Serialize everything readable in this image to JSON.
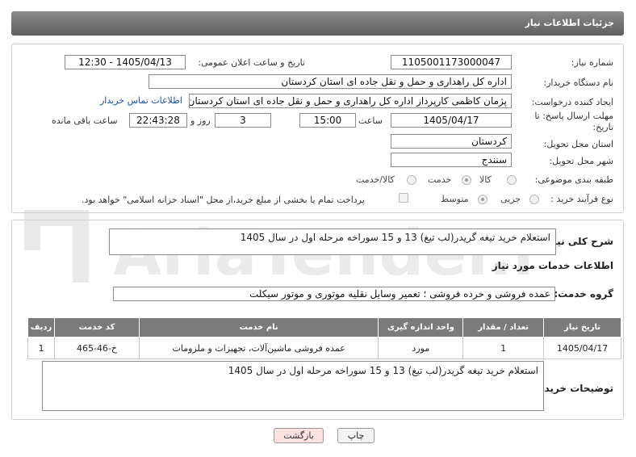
{
  "header": {
    "title": "جزئیات اطلاعات نیاز"
  },
  "form": {
    "need_number_label": "شماره نیاز:",
    "need_number": "1105001173000047",
    "announce_label": "تاریخ و ساعت اعلان عمومی:",
    "announce_value": "1405/04/13 - 12:30",
    "buyer_label": "نام دستگاه خریدار:",
    "buyer_value": "اداره کل راهداری و حمل و نقل جاده ای استان کردستان",
    "creator_label": "ایجاد کننده درخواست:",
    "creator_value": "پژمان کاظمی کارپرداز اداره کل راهداری و حمل و نقل جاده ای استان کردستان",
    "contact_link": "اطلاعات تماس خریدار",
    "deadline_label_1": "مهلت ارسال پاسخ: تا",
    "deadline_label_2": "تاریخ:",
    "deadline_date": "1405/04/17",
    "time_label": "ساعت",
    "deadline_time": "15:00",
    "days_value": "3",
    "days_label": "روز و",
    "remaining_time": "22:43:28",
    "remaining_label": "ساعت باقی مانده",
    "province_label": "استان محل تحویل:",
    "province_value": "کردستان",
    "city_label": "شهر محل تحویل:",
    "city_value": "سنندج",
    "category_label": "طبقه بندی موضوعی:",
    "category_options": [
      "کالا",
      "خدمت",
      "کالا/خدمت"
    ],
    "process_label": "نوع فرآیند خرید :",
    "process_options": [
      "جزیی",
      "متوسط"
    ],
    "payment_note": "پرداخت تمام یا بخشی از مبلغ خرید،از محل \"اسناد خزانه اسلامی\" خواهد بود."
  },
  "details": {
    "summary_label": "شرح کلی نیاز:",
    "summary_value": "استعلام خرید تیغه گریدر(لب تیغ) 13 و 15 سوراخه مرحله اول در سال 1405",
    "services_title": "اطلاعات خدمات مورد نیاز",
    "group_label": "گروه خدمت:",
    "group_value": "عمده فروشی و خرده فروشی ؛ تعمیر وسایل نقلیه موتوری و موتور سیکلت",
    "table": {
      "headers": [
        "ردیف",
        "کد خدمت",
        "نام خدمت",
        "واحد اندازه گیری",
        "تعداد / مقدار",
        "تاریخ نیاز"
      ],
      "rows": [
        [
          "1",
          "خ-46-465",
          "عمده فروشی ماشین‌آلات، تجهیزات و ملزومات",
          "مورد",
          "1",
          "1405/04/17"
        ]
      ]
    },
    "buyer_notes_label": "توضیحات خریدار:",
    "buyer_notes_value": "استعلام خرید تیغه گریدر(لب تیغ) 13 و 15 سوراخه مرحله اول در سال 1405"
  },
  "buttons": {
    "print": "چاپ",
    "back": "بازگشت"
  },
  "watermark": {
    "text": "AriaTender.net"
  },
  "colors": {
    "header": "#6f6f6f",
    "link": "#1a4fa8",
    "back_button": "#fde2e2"
  }
}
